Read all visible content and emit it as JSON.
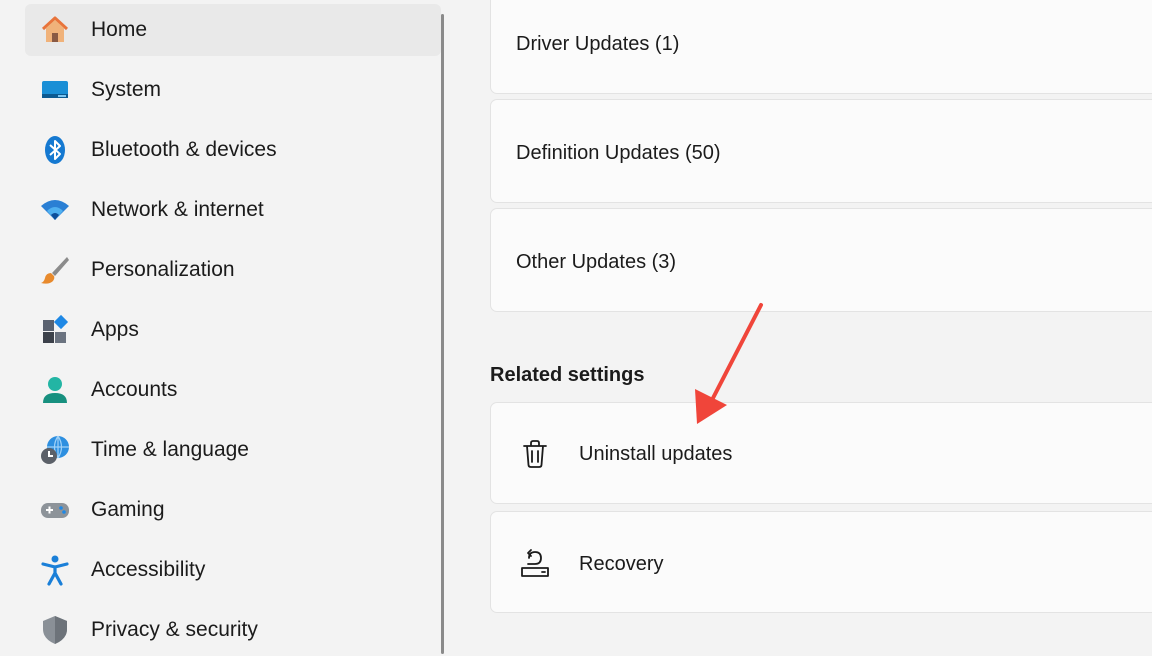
{
  "sidebar": {
    "items": [
      {
        "label": "Home",
        "icon": "home-icon"
      },
      {
        "label": "System",
        "icon": "system-icon"
      },
      {
        "label": "Bluetooth & devices",
        "icon": "bluetooth-icon"
      },
      {
        "label": "Network & internet",
        "icon": "wifi-icon"
      },
      {
        "label": "Personalization",
        "icon": "brush-icon"
      },
      {
        "label": "Apps",
        "icon": "apps-icon"
      },
      {
        "label": "Accounts",
        "icon": "account-icon"
      },
      {
        "label": "Time & language",
        "icon": "globe-clock-icon"
      },
      {
        "label": "Gaming",
        "icon": "gamepad-icon"
      },
      {
        "label": "Accessibility",
        "icon": "accessibility-icon"
      },
      {
        "label": "Privacy & security",
        "icon": "shield-icon"
      }
    ],
    "selected": "Home"
  },
  "main": {
    "update_history": [
      {
        "label": "Driver Updates (1)"
      },
      {
        "label": "Definition Updates (50)"
      },
      {
        "label": "Other Updates (3)"
      }
    ],
    "related_settings_title": "Related settings",
    "related": [
      {
        "label": "Uninstall updates",
        "icon": "trash-icon"
      },
      {
        "label": "Recovery",
        "icon": "recovery-icon"
      }
    ]
  },
  "colors": {
    "accent": "#0067c0",
    "annotation_arrow": "#f0453a"
  }
}
